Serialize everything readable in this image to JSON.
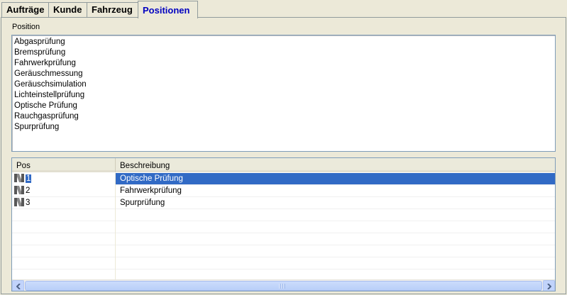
{
  "tabs": [
    {
      "label": "Aufträge",
      "active": false
    },
    {
      "label": "Kunde",
      "active": false
    },
    {
      "label": "Fahrzeug",
      "active": false
    },
    {
      "label": "Positionen",
      "active": true
    }
  ],
  "position_section": {
    "label": "Position",
    "items": [
      "Abgasprüfung",
      "Bremsprüfung",
      "Fahrwerkprüfung",
      "Geräuschmessung",
      "Geräuschsimulation",
      "Lichteinstellprüfung",
      "Optische Prüfung",
      "Rauchgasprüfung",
      "Spurprüfung"
    ]
  },
  "grid": {
    "columns": [
      "Pos",
      "Beschreibung"
    ],
    "rows": [
      {
        "pos": "1",
        "beschreibung": "Optische Prüfung",
        "selected": true,
        "icon": "new-record-icon"
      },
      {
        "pos": "2",
        "beschreibung": "Fahrwerkprüfung",
        "selected": false,
        "icon": "new-record-icon"
      },
      {
        "pos": "3",
        "beschreibung": "Spurprüfung",
        "selected": false,
        "icon": "new-record-icon"
      }
    ]
  },
  "colors": {
    "active_tab_text": "#0000c0",
    "selection": "#316ac5",
    "window_bg": "#ece9d8"
  }
}
